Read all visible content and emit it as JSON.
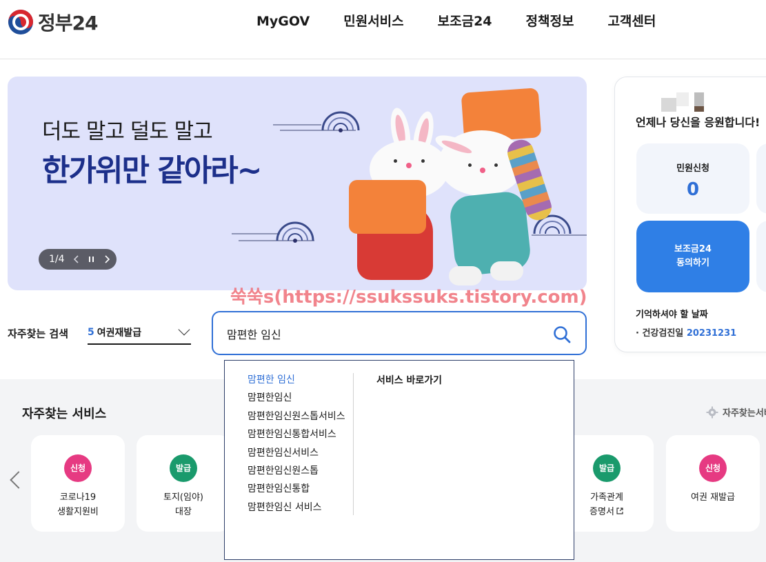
{
  "header": {
    "logo_text": "정부24",
    "nav": [
      "MyGOV",
      "민원서비스",
      "보조금24",
      "정책정보",
      "고객센터"
    ]
  },
  "banner": {
    "line1": "더도 말고 덜도 말고",
    "line2": "한가위만 같아라~",
    "pager_count": "1/4"
  },
  "side_panel": {
    "greeting": "언제나 당신을 응원합니다!",
    "apply_label": "민원신청",
    "apply_count": "0",
    "subsidy_line1": "보조금24",
    "subsidy_line2": "동의하기",
    "remember_title": "기억하셔야 할 날짜",
    "remember_item_label": "건강검진일",
    "remember_item_date": "20231231"
  },
  "watermark": "쑥쑥s(https://ssukssuks.tistory.com)",
  "frequent_search": {
    "label": "자주찾는 검색",
    "selected_rank": "5",
    "selected_value": "여권재발급"
  },
  "search": {
    "value": "맘편한 임신"
  },
  "dropdown": {
    "suggestions": [
      "맘편한 임신",
      "맘편한임신",
      "맘편한임신원스톱서비스",
      "맘편한임신통합서비스",
      "맘편한임신서비스",
      "맘편한임신원스톱",
      "맘편한임신통합",
      "맘편한임신 서비스"
    ],
    "shortcut_title": "서비스 바로가기"
  },
  "frequent_services": {
    "title": "자주찾는 서비스",
    "settings_label": "자주찾는서비",
    "cards": [
      {
        "badge": "신청",
        "badge_color": "#e63a82",
        "line1": "코로나19",
        "line2": "생활지원비"
      },
      {
        "badge": "발급",
        "badge_color": "#1a9a6c",
        "line1": "토지(임야)",
        "line2": "대장"
      },
      {
        "badge": "발급",
        "badge_color": "#1a9a6c",
        "line1": "가족관계",
        "line2": "증명서"
      },
      {
        "badge": "신청",
        "badge_color": "#e63a82",
        "line1": "여권 재발급",
        "line2": ""
      }
    ]
  },
  "colors": {
    "accent": "#2f6fd6",
    "banner_bg": "#dfe2fb",
    "banner_title": "#1c2f8a"
  }
}
